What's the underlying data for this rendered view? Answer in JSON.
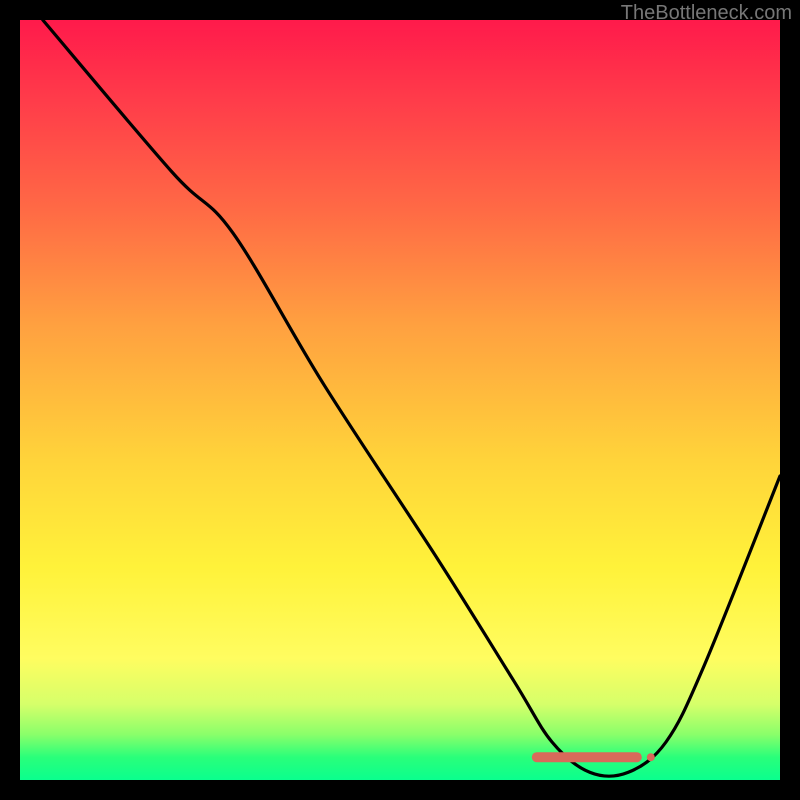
{
  "watermark": "TheBottleneck.com",
  "chart_data": {
    "type": "line",
    "title": "",
    "xlabel": "",
    "ylabel": "",
    "xlim": [
      0,
      100
    ],
    "ylim": [
      0,
      100
    ],
    "series": [
      {
        "name": "curve",
        "x": [
          3,
          20,
          28,
          40,
          55,
          65,
          70,
          75,
          80,
          85,
          90,
          100
        ],
        "values": [
          100,
          80,
          72,
          52,
          29,
          13,
          5,
          1,
          1,
          5,
          15,
          40
        ]
      }
    ],
    "annotation_marker": {
      "shape": "flat-segment",
      "x_range": [
        68,
        83
      ],
      "y": 3,
      "color": "#d86a5a"
    },
    "background_gradient": {
      "direction": "vertical",
      "stops": [
        {
          "pos": 0,
          "color": "#ff1a4b"
        },
        {
          "pos": 25,
          "color": "#ff6a45"
        },
        {
          "pos": 58,
          "color": "#ffd43a"
        },
        {
          "pos": 84,
          "color": "#fffd60"
        },
        {
          "pos": 97,
          "color": "#2aff7a"
        },
        {
          "pos": 100,
          "color": "#0aff8e"
        }
      ]
    }
  }
}
